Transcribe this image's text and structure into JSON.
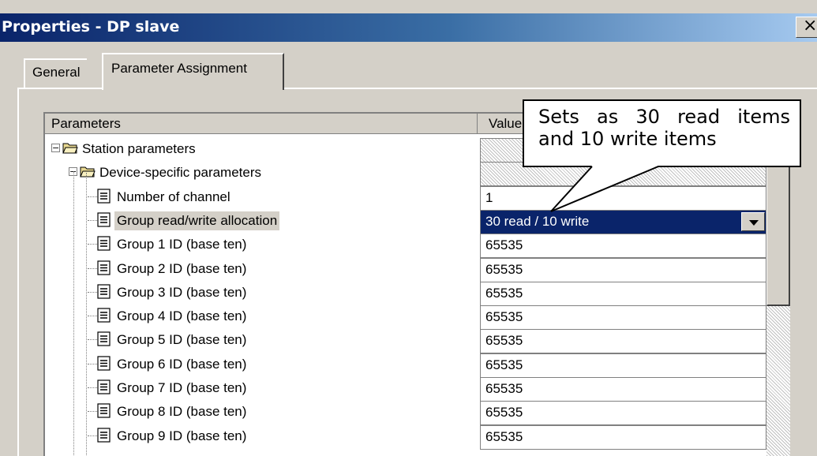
{
  "window": {
    "title": "Properties - DP slave",
    "close_symbol": "×"
  },
  "tabs": [
    {
      "label": "General",
      "active": false
    },
    {
      "label": "Parameter Assignment",
      "active": true
    }
  ],
  "table": {
    "columns": [
      "Parameters",
      "Value"
    ],
    "rows": [
      {
        "label": "Station parameters",
        "value": "",
        "icon": "folder-open-icon",
        "expander": "−"
      },
      {
        "label": "Device-specific parameters",
        "value": "",
        "icon": "folder-open-icon",
        "expander": "−"
      },
      {
        "label": "Number of channel",
        "value": "1",
        "icon": "parameter-icon"
      },
      {
        "label": "Group read/write allocation",
        "value": "30 read / 10 write",
        "icon": "parameter-icon",
        "selected": true
      },
      {
        "label": "Group 1 ID (base ten)",
        "value": "65535",
        "icon": "parameter-icon"
      },
      {
        "label": "Group 2 ID (base ten)",
        "value": "65535",
        "icon": "parameter-icon"
      },
      {
        "label": "Group 3 ID (base ten)",
        "value": "65535",
        "icon": "parameter-icon"
      },
      {
        "label": "Group 4 ID (base ten)",
        "value": "65535",
        "icon": "parameter-icon"
      },
      {
        "label": "Group 5 ID (base ten)",
        "value": "65535",
        "icon": "parameter-icon"
      },
      {
        "label": "Group 6 ID (base ten)",
        "value": "65535",
        "icon": "parameter-icon"
      },
      {
        "label": "Group 7 ID (base ten)",
        "value": "65535",
        "icon": "parameter-icon"
      },
      {
        "label": "Group 8 ID (base ten)",
        "value": "65535",
        "icon": "parameter-icon"
      },
      {
        "label": "Group 9 ID (base ten)",
        "value": "65535",
        "icon": "parameter-icon"
      }
    ]
  },
  "callout": {
    "line1": [
      "Sets",
      "as",
      "30",
      "read",
      "items"
    ],
    "line2": "and 10 write items"
  }
}
